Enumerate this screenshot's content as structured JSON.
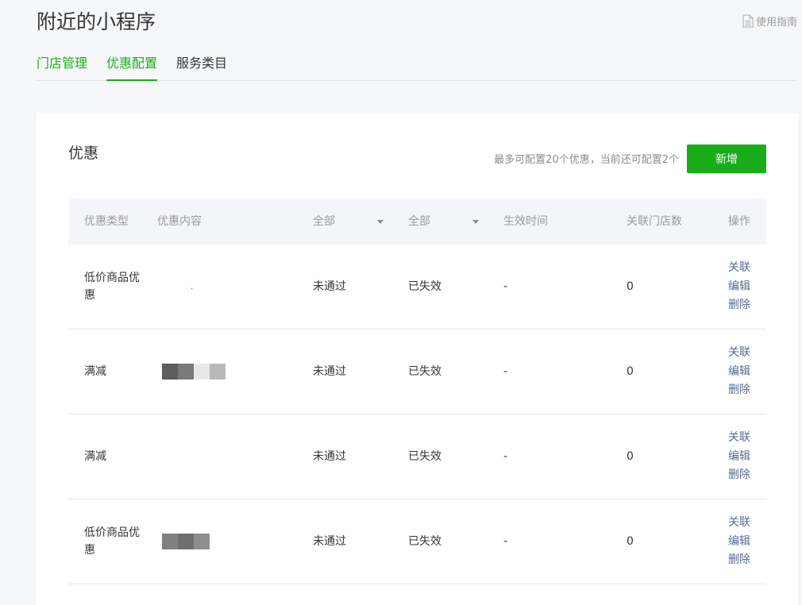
{
  "header": {
    "title": "附近的小程序",
    "guide_label": "使用指南"
  },
  "tabs": [
    {
      "label": "门店管理"
    },
    {
      "label": "优惠配置"
    },
    {
      "label": "服务类目"
    }
  ],
  "panel": {
    "title": "优惠",
    "quota_text": "最多可配置20个优惠，当前还可配置2个",
    "add_label": "新增"
  },
  "table": {
    "columns": {
      "type": "优惠类型",
      "content": "优惠内容",
      "audit_filter": "全部",
      "status_filter": "全部",
      "time": "生效时间",
      "store_count": "关联门店数",
      "ops": "操作"
    },
    "rows": [
      {
        "type": "低价商品优惠",
        "content_mark": ".",
        "audit": "未通过",
        "status": "已失效",
        "time": "-",
        "store_count": "0",
        "ops": {
          "link": "关联",
          "edit": "编辑",
          "delete": "删除"
        }
      },
      {
        "type": "满减",
        "content_image_colors": [
          "#5d5d5d",
          "#7a7a7a",
          "#e8e8e8",
          "#b9b9b9"
        ],
        "audit": "未通过",
        "status": "已失效",
        "time": "-",
        "store_count": "0",
        "ops": {
          "link": "关联",
          "edit": "编辑",
          "delete": "删除"
        }
      },
      {
        "type": "满减",
        "audit": "未通过",
        "status": "已失效",
        "time": "-",
        "store_count": "0",
        "ops": {
          "link": "关联",
          "edit": "编辑",
          "delete": "删除"
        }
      },
      {
        "type": "低价商品优惠",
        "content_image_colors": [
          "#808080",
          "#6e6e6e",
          "#8f8f8f"
        ],
        "audit": "未通过",
        "status": "已失效",
        "time": "-",
        "store_count": "0",
        "ops": {
          "link": "关联",
          "edit": "编辑",
          "delete": "删除"
        }
      }
    ]
  },
  "colors": {
    "accent": "#1aad19",
    "link": "#576b95",
    "muted": "#9a9a9a"
  },
  "icons": {
    "guide": "document-icon",
    "filter": "caret-down-icon"
  }
}
